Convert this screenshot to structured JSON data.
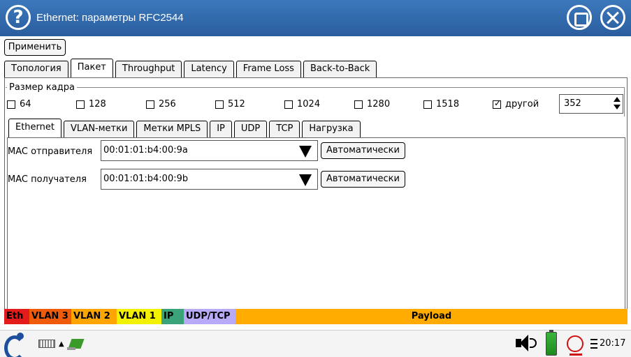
{
  "window": {
    "title": "Ethernet: параметры RFC2544",
    "help_label": "?"
  },
  "toolbar": {
    "apply_label": "Применить"
  },
  "main_tabs": [
    {
      "label": "Топология",
      "active": false
    },
    {
      "label": "Пакет",
      "active": true
    },
    {
      "label": "Throughput",
      "active": false
    },
    {
      "label": "Latency",
      "active": false
    },
    {
      "label": "Frame Loss",
      "active": false
    },
    {
      "label": "Back-to-Back",
      "active": false
    }
  ],
  "frame_size": {
    "legend": "Размер кадра",
    "options": [
      {
        "label": "64",
        "checked": false
      },
      {
        "label": "128",
        "checked": false
      },
      {
        "label": "256",
        "checked": false
      },
      {
        "label": "512",
        "checked": false
      },
      {
        "label": "1024",
        "checked": false
      },
      {
        "label": "1280",
        "checked": false
      },
      {
        "label": "1518",
        "checked": false
      },
      {
        "label": "другой",
        "checked": true
      }
    ],
    "custom_value": "352"
  },
  "sub_tabs": [
    {
      "label": "Ethernet",
      "active": true
    },
    {
      "label": "VLAN-метки",
      "active": false
    },
    {
      "label": "Метки MPLS",
      "active": false
    },
    {
      "label": "IP",
      "active": false
    },
    {
      "label": "UDP",
      "active": false
    },
    {
      "label": "TCP",
      "active": false
    },
    {
      "label": "Нагрузка",
      "active": false
    }
  ],
  "ethernet": {
    "src_mac_label": "MAC отправителя",
    "src_mac_value": "00:01:01:b4:00:9a",
    "dst_mac_label": "MAC получателя",
    "dst_mac_value": "00:01:01:b4:00:9b",
    "auto_label": "Автоматически"
  },
  "layers": [
    {
      "label": "Eth",
      "color": "#e31b1b"
    },
    {
      "label": "VLAN 3",
      "color": "#f05b0a"
    },
    {
      "label": "VLAN 2",
      "color": "#ffa500"
    },
    {
      "label": "VLAN 1",
      "color": "#f2f200"
    },
    {
      "label": "IP",
      "color": "#3aa37a"
    },
    {
      "label": "UDP/TCP",
      "color": "#b9aaf7"
    },
    {
      "label": "Payload",
      "color": "#ffab00"
    }
  ],
  "taskbar": {
    "time": "20:17",
    "icons": [
      "menu-logo-icon",
      "keyboard-icon",
      "network-icon",
      "speaker-icon",
      "battery-icon",
      "record-icon",
      "clock-icon"
    ]
  }
}
